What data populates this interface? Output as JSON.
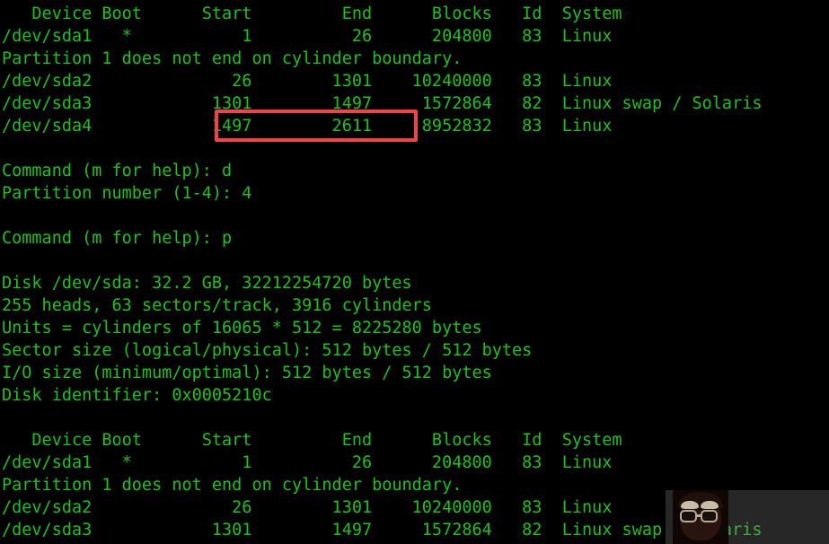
{
  "terminal": {
    "program": "fdisk",
    "background_color": "#000000",
    "text_color": "#20c020",
    "lines": [
      "   Device Boot      Start         End      Blocks   Id  System",
      "/dev/sda1   *           1          26      204800   83  Linux",
      "Partition 1 does not end on cylinder boundary.",
      "/dev/sda2              26        1301    10240000   83  Linux",
      "/dev/sda3            1301        1497     1572864   82  Linux swap / Solaris",
      "/dev/sda4            1497        2611     8952832   83  Linux",
      "",
      "Command (m for help): d",
      "Partition number (1-4): 4",
      "",
      "Command (m for help): p",
      "",
      "Disk /dev/sda: 32.2 GB, 32212254720 bytes",
      "255 heads, 63 sectors/track, 3916 cylinders",
      "Units = cylinders of 16065 * 512 = 8225280 bytes",
      "Sector size (logical/physical): 512 bytes / 512 bytes",
      "I/O size (minimum/optimal): 512 bytes / 512 bytes",
      "Disk identifier: 0x0005210c",
      "",
      "   Device Boot      Start         End      Blocks   Id  System",
      "/dev/sda1   *           1          26      204800   83  Linux",
      "Partition 1 does not end on cylinder boundary.",
      "/dev/sda2              26        1301    10240000   83  Linux",
      "/dev/sda3            1301        1497     1572864   82  Linux swap / Solaris"
    ]
  },
  "partition_table_top": {
    "headers": [
      "Device",
      "Boot",
      "Start",
      "End",
      "Blocks",
      "Id",
      "System"
    ],
    "rows": [
      {
        "device": "/dev/sda1",
        "boot": "*",
        "start": "1",
        "end": "26",
        "blocks": "204800",
        "id": "83",
        "system": "Linux"
      },
      {
        "device": "/dev/sda2",
        "boot": "",
        "start": "26",
        "end": "1301",
        "blocks": "10240000",
        "id": "83",
        "system": "Linux"
      },
      {
        "device": "/dev/sda3",
        "boot": "",
        "start": "1301",
        "end": "1497",
        "blocks": "1572864",
        "id": "82",
        "system": "Linux swap / Solaris"
      },
      {
        "device": "/dev/sda4",
        "boot": "",
        "start": "1497",
        "end": "2611",
        "blocks": "8952832",
        "id": "83",
        "system": "Linux"
      }
    ],
    "warning": "Partition 1 does not end on cylinder boundary."
  },
  "partition_table_bottom": {
    "headers": [
      "Device",
      "Boot",
      "Start",
      "End",
      "Blocks",
      "Id",
      "System"
    ],
    "rows": [
      {
        "device": "/dev/sda1",
        "boot": "*",
        "start": "1",
        "end": "26",
        "blocks": "204800",
        "id": "83",
        "system": "Linux"
      },
      {
        "device": "/dev/sda2",
        "boot": "",
        "start": "26",
        "end": "1301",
        "blocks": "10240000",
        "id": "83",
        "system": "Linux"
      },
      {
        "device": "/dev/sda3",
        "boot": "",
        "start": "1301",
        "end": "1497",
        "blocks": "1572864",
        "id": "82",
        "system": "Linux swap / Solaris"
      }
    ],
    "warning": "Partition 1 does not end on cylinder boundary."
  },
  "commands": [
    {
      "prompt": "Command (m for help): ",
      "input": "d"
    },
    {
      "prompt": "Partition number (1-4): ",
      "input": "4"
    },
    {
      "prompt": "Command (m for help): ",
      "input": "p"
    }
  ],
  "disk_info": {
    "disk": "Disk /dev/sda: 32.2 GB, 32212254720 bytes",
    "geometry": "255 heads, 63 sectors/track, 3916 cylinders",
    "units": "Units = cylinders of 16065 * 512 = 8225280 bytes",
    "sector_size": "Sector size (logical/physical): 512 bytes / 512 bytes",
    "io_size": "I/O size (minimum/optimal): 512 bytes / 512 bytes",
    "identifier": "Disk identifier: 0x0005210c"
  },
  "annotation": {
    "highlight_color": "#f1444a",
    "target_line": "/dev/sda4",
    "highlighted_values": [
      "1497",
      "2611"
    ],
    "shape": "rectangle"
  },
  "watermark": {
    "position": "bottom-right",
    "overlay_color": "rgba(128,128,128,0.30)",
    "logo": "face-with-sunglasses-avatar"
  }
}
